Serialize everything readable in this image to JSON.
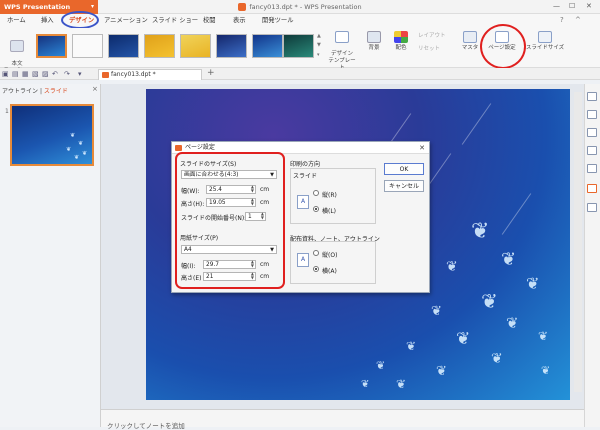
{
  "app": {
    "menu_button": "WPS Presentation",
    "window_title": "fancy013.dpt * - WPS Presentation"
  },
  "menu_tabs": [
    "ホーム",
    "挿入",
    "デザイン",
    "アニメーション",
    "スライド ショー",
    "校閲",
    "表示",
    "開発ツール"
  ],
  "ribbon": {
    "template_button": "本文\nテンプレート",
    "design_template": "デザイン\nテンプレート",
    "background": "背景",
    "color_scheme": "配色",
    "layout": "レイアウト",
    "reset": "リセット",
    "master": "マスタ",
    "page_setup": "ページ設定",
    "slide_size": "スライドサイズ"
  },
  "document_tab": "fancy013.dpt *",
  "left_panel": {
    "tab_outline": "アウトライン",
    "tab_slides": "スライド",
    "slide_number": "1"
  },
  "notes_placeholder": "クリックしてノートを追加",
  "dialog": {
    "title": "ページ設定",
    "slide_size_label": "スライドのサイズ(S)",
    "slide_size_value": "画面に合わせる(4:3)",
    "width_label": "幅(W):",
    "width_value": "25.4",
    "height_label": "高さ(H):",
    "height_value": "19.05",
    "unit": "cm",
    "start_number_label": "スライドの開始番号(N):",
    "start_number_value": "1",
    "paper_size_label": "用紙サイズ(P)",
    "paper_size_value": "A4",
    "paper_width_label": "幅(I):",
    "paper_width_value": "29.7",
    "paper_height_label": "高さ(E)",
    "paper_height_value": "21",
    "orientation_label": "印刷の方向",
    "slide_group_label": "スライド",
    "portrait_r": "縦(R)",
    "landscape_l": "横(L)",
    "handouts_label": "配布資料、ノート、アウトライン",
    "portrait_o": "縦(O)",
    "landscape_a": "横(A)",
    "ok": "OK",
    "cancel": "キャンセル",
    "slide_orientation_selected": "landscape",
    "handout_orientation_selected": "landscape"
  }
}
